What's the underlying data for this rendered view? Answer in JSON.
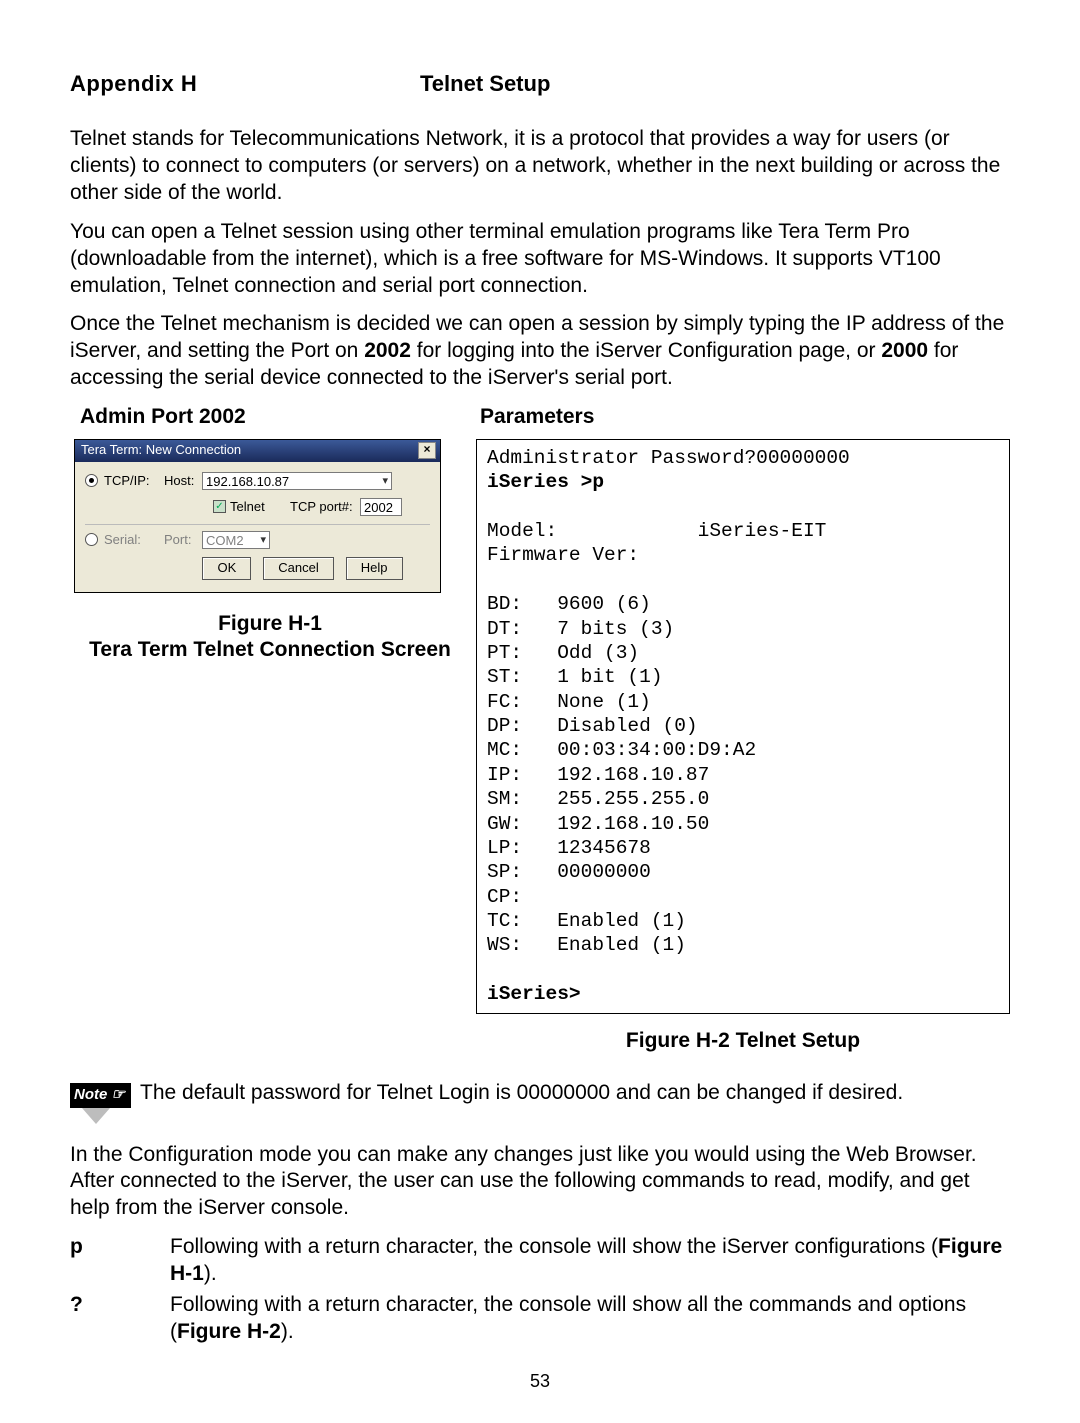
{
  "header": {
    "left": "Appendix  H",
    "right": "Telnet Setup"
  },
  "para1": "Telnet stands for Telecommunications Network, it is a protocol that provides a way for users (or clients) to connect to computers (or servers) on a network, whether in the next building or across the other side of the world.",
  "para2": "You can open a Telnet session using other terminal emulation programs like Tera Term Pro (downloadable from the internet), which is a free software for MS-Windows. It supports VT100 emulation, Telnet connection and serial port connection.",
  "para3_a": "Once the Telnet mechanism is decided we can open a session by simply typing the IP address of the iServer, and setting the Port on ",
  "para3_b": "2002",
  "para3_c": " for logging into the iServer Configuration page, or ",
  "para3_d": "2000",
  "para3_e": " for accessing the serial device connected to the iServer's serial port.",
  "subhead_left": "Admin Port 2002",
  "subhead_right": "Parameters",
  "dialog": {
    "title": "Tera Term: New Connection",
    "tcpip_label": "TCP/IP:",
    "host_label": "Host:",
    "host_value": "192.168.10.87",
    "telnet_label": "Telnet",
    "tcpport_label": "TCP port#:",
    "tcpport_value": "2002",
    "serial_label": "Serial:",
    "port_label": "Port:",
    "port_value": "COM2",
    "ok": "OK",
    "cancel": "Cancel",
    "help": "Help"
  },
  "fig1_l1": "Figure H-1",
  "fig1_l2": "Tera Term Telnet Connection Screen",
  "term": {
    "l1": "Administrator Password?00000000",
    "l2": "iSeries >p",
    "blank": "",
    "model_lbl": "Model:",
    "model_val": "iSeries-EIT",
    "fw": "Firmware Ver:",
    "rows": [
      [
        "BD:",
        "9600 (6)"
      ],
      [
        "DT:",
        "7 bits (3)"
      ],
      [
        "PT:",
        "Odd (3)"
      ],
      [
        "ST:",
        "1 bit (1)"
      ],
      [
        "FC:",
        "None (1)"
      ],
      [
        "DP:",
        "Disabled (0)"
      ],
      [
        "MC:",
        "00:03:34:00:D9:A2"
      ],
      [
        "IP:",
        "192.168.10.87"
      ],
      [
        "SM:",
        "255.255.255.0"
      ],
      [
        "GW:",
        "192.168.10.50"
      ],
      [
        "LP:",
        "12345678"
      ],
      [
        "SP:",
        "00000000"
      ],
      [
        "CP:",
        ""
      ],
      [
        "TC:",
        "Enabled (1)"
      ],
      [
        "WS:",
        "Enabled (1)"
      ]
    ],
    "prompt": "iSeries>"
  },
  "fig2": "Figure H-2  Telnet Setup",
  "note_label": "Note ☞",
  "note_text": "The default password for Telnet Login is 00000000 and can be changed if desired.",
  "para4": "In the Configuration mode you can make any changes just like you would using the Web Browser.  After connected to the iServer, the user can use the following commands to read, modify, and get help from the iServer console.",
  "cmd_p_key": "p",
  "cmd_p_a": "Following with a return character, the console will show the iServer configurations (",
  "cmd_p_b": "Figure H-1",
  "cmd_p_c": ").",
  "cmd_q_key": "?",
  "cmd_q_a": "Following with a return character, the console will show all the commands and options (",
  "cmd_q_b": "Figure H-2",
  "cmd_q_c": ").",
  "page": "53"
}
